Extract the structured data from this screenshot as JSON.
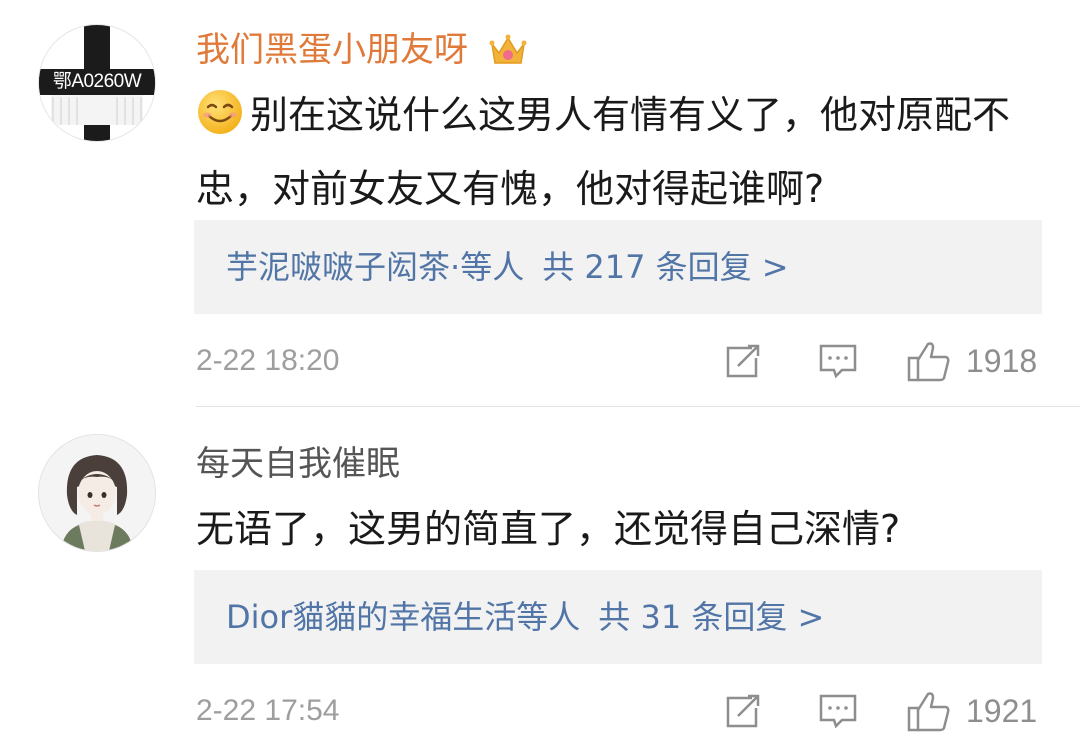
{
  "comments": [
    {
      "username": "我们黑蛋小朋友呀",
      "username_color": "#e07a3a",
      "avatar_text": "鄂A0260W",
      "badge": "crown-icon",
      "emoji": "smile-icon",
      "text": "别在这说什么这男人有情有义了，他对原配不忠，对前女友又有愧，他对得起谁啊?",
      "replies": {
        "names": "芋泥啵啵子闳茶",
        "separator": "·",
        "suffix": "等人",
        "count_label": "共 217 条回复 >"
      },
      "timestamp": "2-22 18:20",
      "likes": "1918"
    },
    {
      "username": "每天自我催眠",
      "username_color": "#555555",
      "avatar": "girl-illustration",
      "text": "无语了，这男的简直了，还觉得自己深情?",
      "replies": {
        "names": "Dior貓貓的幸福生活",
        "separator": "",
        "suffix": "等人",
        "count_label": "共 31 条回复 >"
      },
      "timestamp": "2-22 17:54",
      "likes": "1921"
    }
  ],
  "colors": {
    "link": "#5175a6",
    "reply_bg": "#f2f2f2",
    "meta": "#9e9e9e",
    "text": "#1a1a1a"
  }
}
